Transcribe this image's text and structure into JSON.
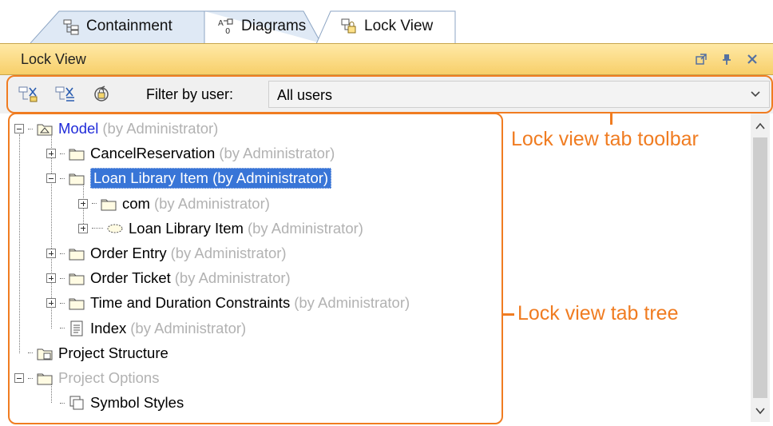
{
  "tabs": [
    {
      "label": "Containment",
      "icon": "containment-tree-icon",
      "active": false
    },
    {
      "label": "Diagrams",
      "icon": "diagrams-icon",
      "active": false
    },
    {
      "label": "Lock View",
      "icon": "lock-view-icon",
      "active": true
    }
  ],
  "panel": {
    "title": "Lock View",
    "header_icons": [
      "float-window-icon",
      "pin-icon",
      "close-icon"
    ]
  },
  "toolbar": {
    "buttons": [
      "unlock-elements-icon",
      "unlock-all-icon",
      "lock-refresh-icon"
    ],
    "filter_label": "Filter by user:",
    "filter_value": "All users"
  },
  "tree": [
    {
      "depth": 0,
      "name": "Model",
      "byline": "(by Administrator)",
      "expander": "minus",
      "icon": "model-package-icon",
      "style": "model"
    },
    {
      "depth": 1,
      "name": "CancelReservation",
      "byline": "(by Administrator)",
      "expander": "plus",
      "icon": "folder-icon"
    },
    {
      "depth": 1,
      "name": "Loan Library Item (by Administrator)",
      "byline": "",
      "expander": "minus",
      "icon": "folder-icon",
      "selected": true
    },
    {
      "depth": 2,
      "name": "com",
      "byline": "(by Administrator)",
      "expander": "plus",
      "icon": "folder-icon"
    },
    {
      "depth": 2,
      "name": "Loan Library Item",
      "byline": "(by Administrator)",
      "expander": "plus",
      "icon": "use-case-icon"
    },
    {
      "depth": 1,
      "name": "Order Entry",
      "byline": "(by Administrator)",
      "expander": "plus",
      "icon": "folder-icon"
    },
    {
      "depth": 1,
      "name": "Order Ticket",
      "byline": "(by Administrator)",
      "expander": "plus",
      "icon": "folder-icon"
    },
    {
      "depth": 1,
      "name": "Time and Duration Constraints",
      "byline": "(by Administrator)",
      "expander": "plus",
      "icon": "folder-icon"
    },
    {
      "depth": 1,
      "name": "Index",
      "byline": "(by Administrator)",
      "expander": "none",
      "icon": "document-icon"
    },
    {
      "depth": 0,
      "name": "Project Structure",
      "byline": "",
      "expander": "none",
      "icon": "project-structure-icon"
    },
    {
      "depth": 0,
      "name": "Project Options",
      "byline": "",
      "expander": "minus",
      "icon": "folder-icon",
      "style": "dim"
    },
    {
      "depth": 1,
      "name": "Symbol Styles",
      "byline": "",
      "expander": "none",
      "icon": "symbol-styles-icon"
    }
  ],
  "callouts": {
    "toolbar": "Lock view tab toolbar",
    "tree": "Lock view tab tree"
  },
  "colors": {
    "callout": "#f07c21",
    "selection": "#3875d7",
    "panel_header": "#f7cf6a",
    "model_link": "#1f2ad9"
  }
}
